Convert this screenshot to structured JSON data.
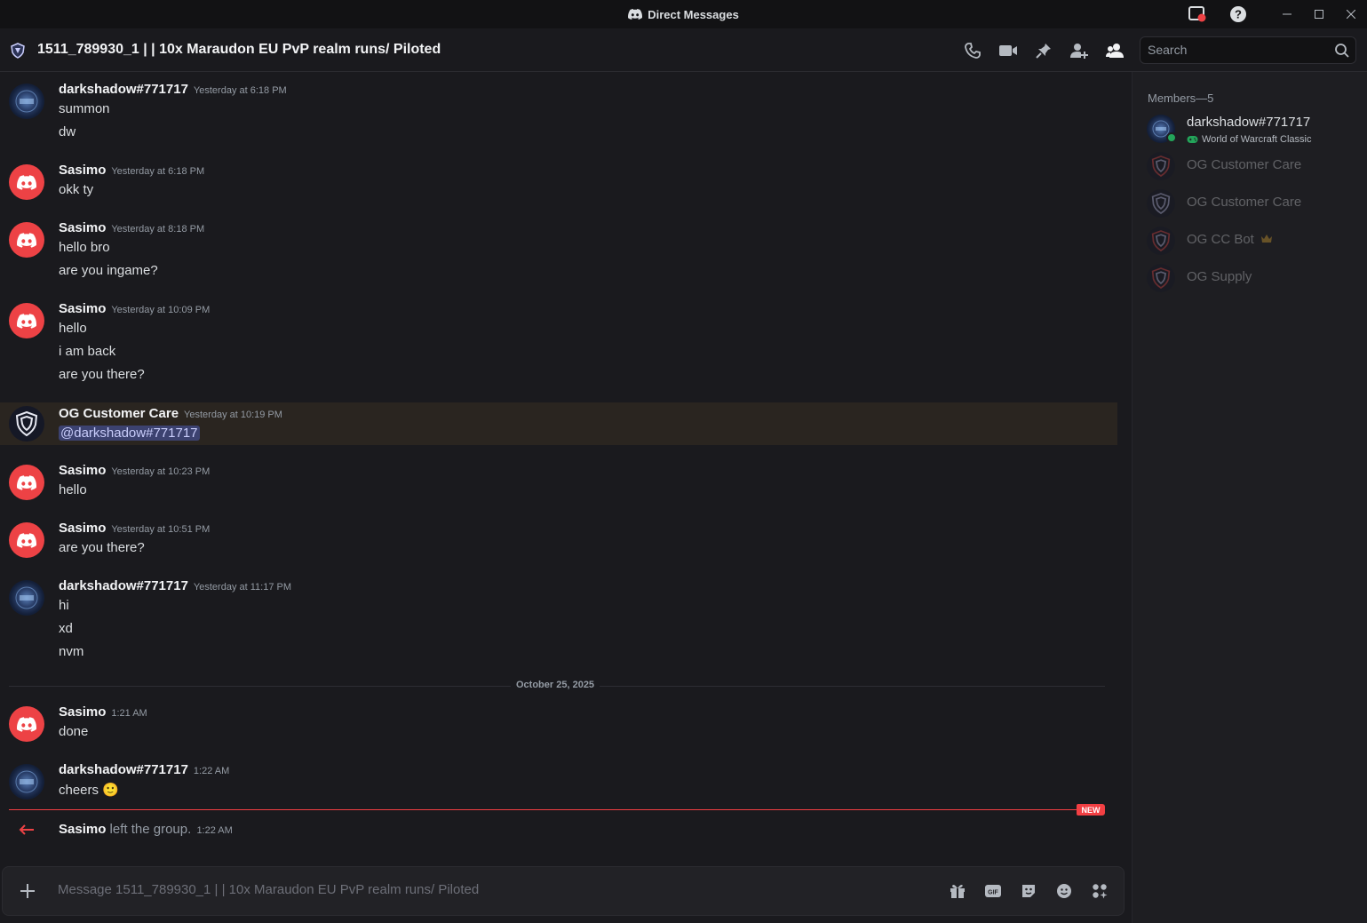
{
  "window": {
    "title": "Direct Messages"
  },
  "header": {
    "channel_title": "1511_789930_1 | | 10x Maraudon EU PvP realm runs/ Piloted"
  },
  "search": {
    "placeholder": "Search"
  },
  "messages": [
    {
      "author": "darkshadow#771717",
      "time": "Yesterday at 6:18 PM",
      "lines": [
        "summon",
        "dw"
      ],
      "avatar": "darkshadow"
    },
    {
      "author": "Sasimo",
      "time": "Yesterday at 6:18 PM",
      "lines": [
        "okk ty"
      ],
      "avatar": "discord-default-red"
    },
    {
      "author": "Sasimo",
      "time": "Yesterday at 8:18 PM",
      "lines": [
        "hello bro",
        "are you ingame?"
      ],
      "avatar": "discord-default-red"
    },
    {
      "author": "Sasimo",
      "time": "Yesterday at 10:09 PM",
      "lines": [
        "hello",
        "i am back",
        "are you there?"
      ],
      "avatar": "discord-default-red"
    },
    {
      "author": "OG Customer Care",
      "time": "Yesterday at 10:19 PM",
      "mention": "@darkshadow#771717",
      "avatar": "og-shield"
    },
    {
      "author": "Sasimo",
      "time": "Yesterday at 10:23 PM",
      "lines": [
        "hello"
      ],
      "avatar": "discord-default-red"
    },
    {
      "author": "Sasimo",
      "time": "Yesterday at 10:51 PM",
      "lines": [
        "are you there?"
      ],
      "avatar": "discord-default-red"
    },
    {
      "author": "darkshadow#771717",
      "time": "Yesterday at 11:17 PM",
      "lines": [
        "hi",
        "xd",
        "nvm"
      ],
      "avatar": "darkshadow"
    },
    {
      "author": "Sasimo",
      "time": "1:21 AM",
      "lines": [
        "done"
      ],
      "avatar": "discord-default-red"
    },
    {
      "author": "darkshadow#771717",
      "time": "1:22 AM",
      "lines": [
        "cheers 🙂"
      ],
      "avatar": "darkshadow"
    }
  ],
  "date_divider": "October 25, 2025",
  "new_badge": "NEW",
  "system_message": {
    "author": "Sasimo",
    "text": "left the group.",
    "time": "1:22 AM"
  },
  "composer": {
    "placeholder": "Message 1511_789930_1 | | 10x Maraudon EU PvP realm runs/ Piloted",
    "gif_label": "GIF"
  },
  "members": {
    "header": "Members—5",
    "list": [
      {
        "name": "darkshadow#771717",
        "activity": "World of Warcraft Classic",
        "status": "online"
      },
      {
        "name": "OG Customer Care",
        "status": "offline"
      },
      {
        "name": "OG Customer Care",
        "status": "offline"
      },
      {
        "name": "OG CC Bot",
        "status": "offline",
        "badge": "crown-icon"
      },
      {
        "name": "OG Supply",
        "status": "offline"
      }
    ]
  },
  "colors": {
    "accent_red": "#ed4245",
    "new_line": "#f23f43",
    "mention_bg": "#3c4270",
    "online": "#23a55a"
  }
}
